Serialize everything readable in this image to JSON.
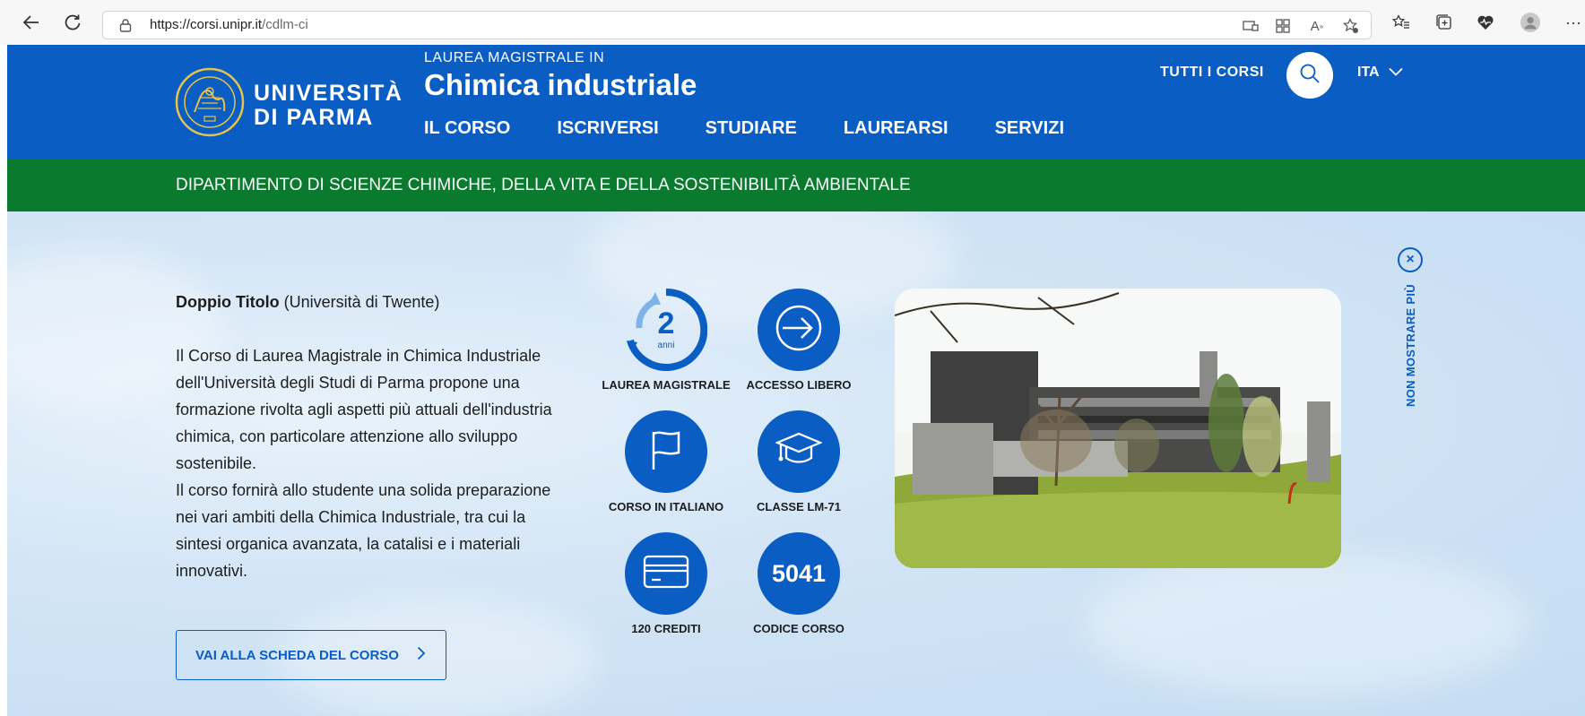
{
  "browser": {
    "url_host": "https://corsi.unipr.it",
    "url_path": "/cdlm-ci"
  },
  "header": {
    "logo_line1": "UNIVERSITÀ",
    "logo_line2": "DI PARMA",
    "course_prefix": "LAUREA MAGISTRALE IN",
    "course_title": "Chimica industriale",
    "menu": [
      "IL CORSO",
      "ISCRIVERSI",
      "STUDIARE",
      "LAUREARSI",
      "SERVIZI"
    ],
    "all_courses": "TUTTI I CORSI",
    "language": "ITA"
  },
  "department": "DIPARTIMENTO DI SCIENZE CHIMICHE, DELLA VITA E DELLA SOSTENIBILITÀ AMBIENTALE",
  "hero": {
    "intro_bold": "Doppio Titolo",
    "intro_rest": " (Università di Twente)",
    "description_1": "Il Corso di Laurea Magistrale in Chimica Industriale dell'Università degli Studi di Parma propone una formazione rivolta agli aspetti più attuali dell'industria chimica, con particolare attenzione allo sviluppo sostenibile.",
    "description_2": "Il corso fornirà allo studente una solida preparazione nei vari ambiti della Chimica Industriale, tra cui la sintesi organica avanzata, la catalisi e i materiali innovativi.",
    "cta": "VAI ALLA SCHEDA DEL CORSO",
    "dismiss": "NON MOSTRARE PIÙ"
  },
  "features": {
    "duration_number": "2",
    "duration_unit": "anni",
    "duration_label": "LAUREA MAGISTRALE",
    "access_label": "ACCESSO LIBERO",
    "language_label": "CORSO IN ITALIANO",
    "class_label": "CLASSE LM-71",
    "credits_label": "120 CREDITI",
    "code_value": "5041",
    "code_label": "CODICE CORSO"
  },
  "colors": {
    "primary_blue": "#0a5dc2",
    "department_green": "#0a7a2f"
  }
}
